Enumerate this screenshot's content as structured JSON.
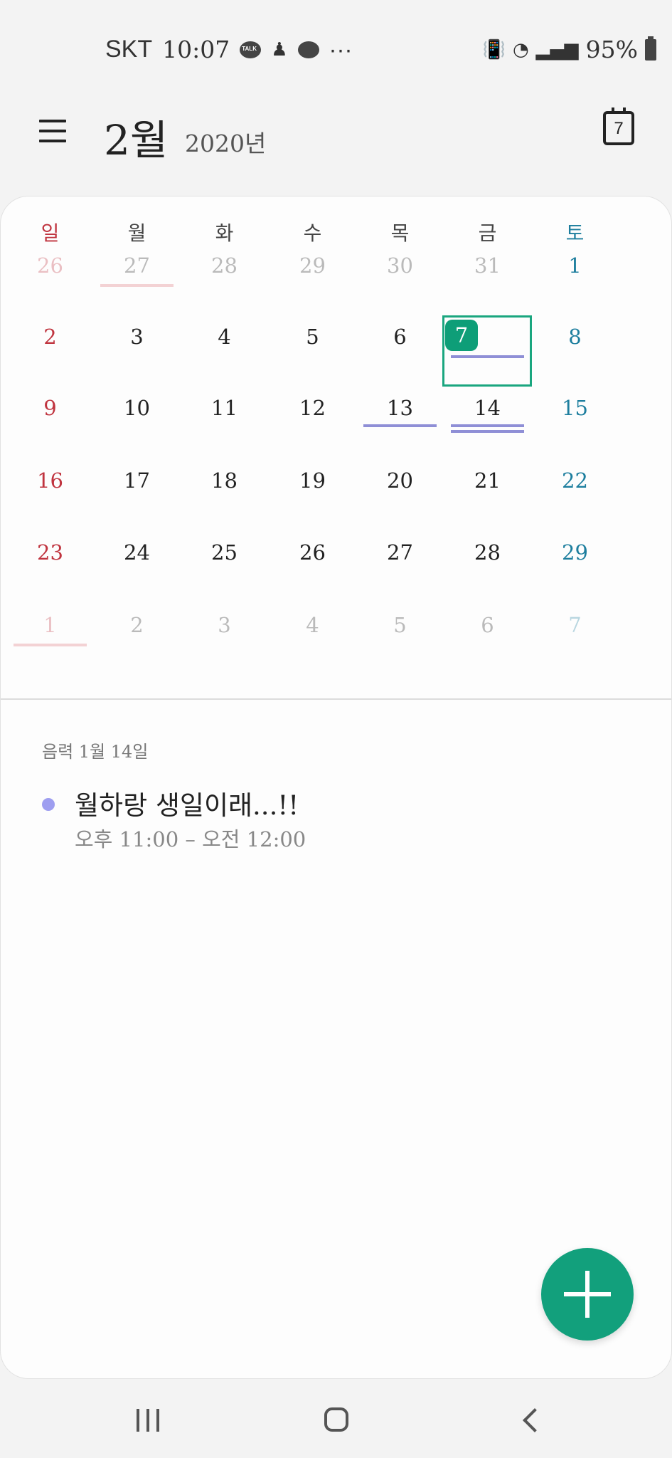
{
  "status_bar": {
    "carrier": "SKT",
    "time": "10:07",
    "more": "···",
    "battery": "95%",
    "left_icons": [
      "kakaotalk-icon",
      "notification-icon",
      "chat-bubble-icon"
    ],
    "right_icons": [
      "vibrate-icon",
      "wifi-icon",
      "signal-icon",
      "battery-icon"
    ]
  },
  "header": {
    "month": "2월",
    "year": "2020년",
    "today_day": "7"
  },
  "colors": {
    "sunday": "#c0343f",
    "saturday": "#1d7e9e",
    "weekday": "#222222",
    "today_badge": "#0e9e78",
    "event_line": "#8f8fd6",
    "fab": "#12a07c"
  },
  "calendar": {
    "weekdays": [
      "일",
      "월",
      "화",
      "수",
      "목",
      "금",
      "토"
    ],
    "weeks": [
      [
        "26",
        "27",
        "28",
        "29",
        "30",
        "31",
        "1"
      ],
      [
        "2",
        "3",
        "4",
        "5",
        "6",
        "7",
        "8"
      ],
      [
        "9",
        "10",
        "11",
        "12",
        "13",
        "14",
        "15"
      ],
      [
        "16",
        "17",
        "18",
        "19",
        "20",
        "21",
        "22"
      ],
      [
        "23",
        "24",
        "25",
        "26",
        "27",
        "28",
        "29"
      ],
      [
        "1",
        "2",
        "3",
        "4",
        "5",
        "6",
        "7"
      ]
    ]
  },
  "detail": {
    "lunar_date": "음력 1월 14일",
    "event_title": "월하랑 생일이래...!!",
    "event_time": "오후 11:00 – 오전 12:00"
  }
}
